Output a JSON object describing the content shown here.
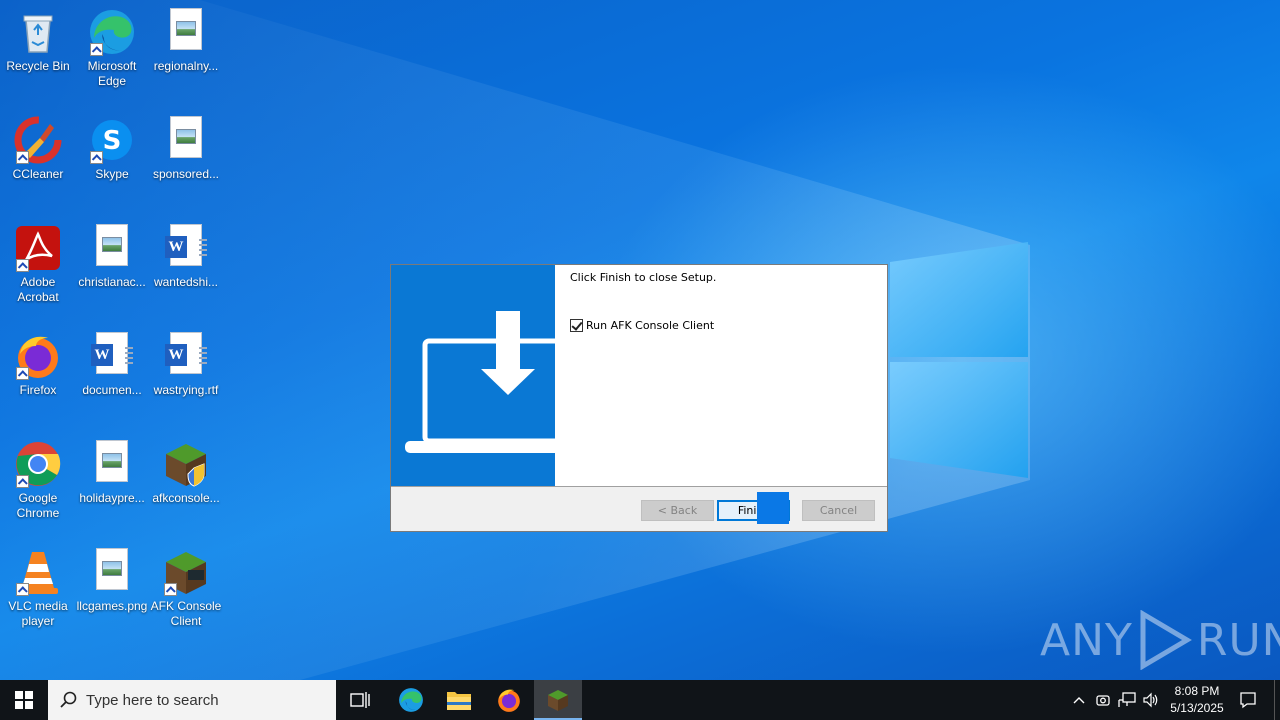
{
  "desktop": {
    "icons": [
      {
        "label": "Recycle Bin"
      },
      {
        "label": "Microsoft Edge"
      },
      {
        "label": "regionalny..."
      },
      {
        "label": "CCleaner"
      },
      {
        "label": "Skype"
      },
      {
        "label": "sponsored..."
      },
      {
        "label": "Adobe Acrobat"
      },
      {
        "label": "christianac..."
      },
      {
        "label": "wantedshi..."
      },
      {
        "label": "Firefox"
      },
      {
        "label": "documen..."
      },
      {
        "label": "wastrying.rtf"
      },
      {
        "label": "Google Chrome"
      },
      {
        "label": "holidaypre..."
      },
      {
        "label": "afkconsole..."
      },
      {
        "label": "VLC media player"
      },
      {
        "label": "llcgames.png"
      },
      {
        "label": "AFK Console Client"
      }
    ]
  },
  "dialog": {
    "message": "Click Finish to close Setup.",
    "checkbox_label": "Run AFK Console Client",
    "checkbox_checked": true,
    "back_label": "< Back",
    "finish_label": "Finish",
    "cancel_label": "Cancel"
  },
  "taskbar": {
    "search_placeholder": "Type here to search",
    "time": "8:08 PM",
    "date": "5/13/2025"
  },
  "watermark": {
    "left_text": "ANY",
    "right_text": "RUN"
  },
  "colors": {
    "accent": "#0078d7",
    "wallpaper": "#0a74e0",
    "taskbar": "#101418"
  }
}
